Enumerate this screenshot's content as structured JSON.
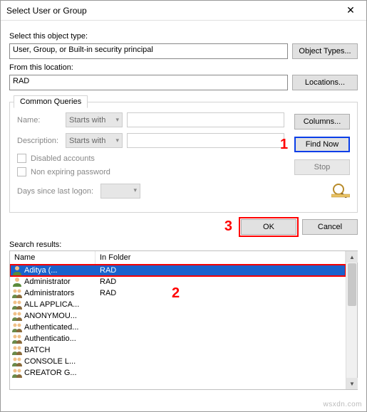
{
  "window": {
    "title": "Select User or Group",
    "close_glyph": "✕"
  },
  "objectType": {
    "label": "Select this object type:",
    "value": "User, Group, or Built-in security principal",
    "button": "Object Types..."
  },
  "location": {
    "label": "From this location:",
    "value": "RAD",
    "button": "Locations..."
  },
  "queries": {
    "tab": "Common Queries",
    "nameLabel": "Name:",
    "nameMode": "Starts with",
    "descLabel": "Description:",
    "descMode": "Starts with",
    "disabled": "Disabled accounts",
    "nonexp": "Non expiring password",
    "daysLabel": "Days since last logon:",
    "columnsBtn": "Columns...",
    "findBtn": "Find Now",
    "stopBtn": "Stop"
  },
  "markers": {
    "one": "1",
    "two": "2",
    "three": "3"
  },
  "actions": {
    "ok": "OK",
    "cancel": "Cancel"
  },
  "results": {
    "label": "Search results:",
    "headers": {
      "name": "Name",
      "folder": "In Folder"
    },
    "rows": [
      {
        "name": "Aditya       (...",
        "folder": "RAD",
        "icon": "user",
        "selected": true
      },
      {
        "name": "Administrator",
        "folder": "RAD",
        "icon": "user"
      },
      {
        "name": "Administrators",
        "folder": "RAD",
        "icon": "group"
      },
      {
        "name": "ALL APPLICA...",
        "folder": "",
        "icon": "group"
      },
      {
        "name": "ANONYMOU...",
        "folder": "",
        "icon": "group"
      },
      {
        "name": "Authenticated...",
        "folder": "",
        "icon": "group"
      },
      {
        "name": "Authenticatio...",
        "folder": "",
        "icon": "group"
      },
      {
        "name": "BATCH",
        "folder": "",
        "icon": "group"
      },
      {
        "name": "CONSOLE L...",
        "folder": "",
        "icon": "group"
      },
      {
        "name": "CREATOR G...",
        "folder": "",
        "icon": "group"
      }
    ]
  },
  "watermark": "wsxdn.com"
}
